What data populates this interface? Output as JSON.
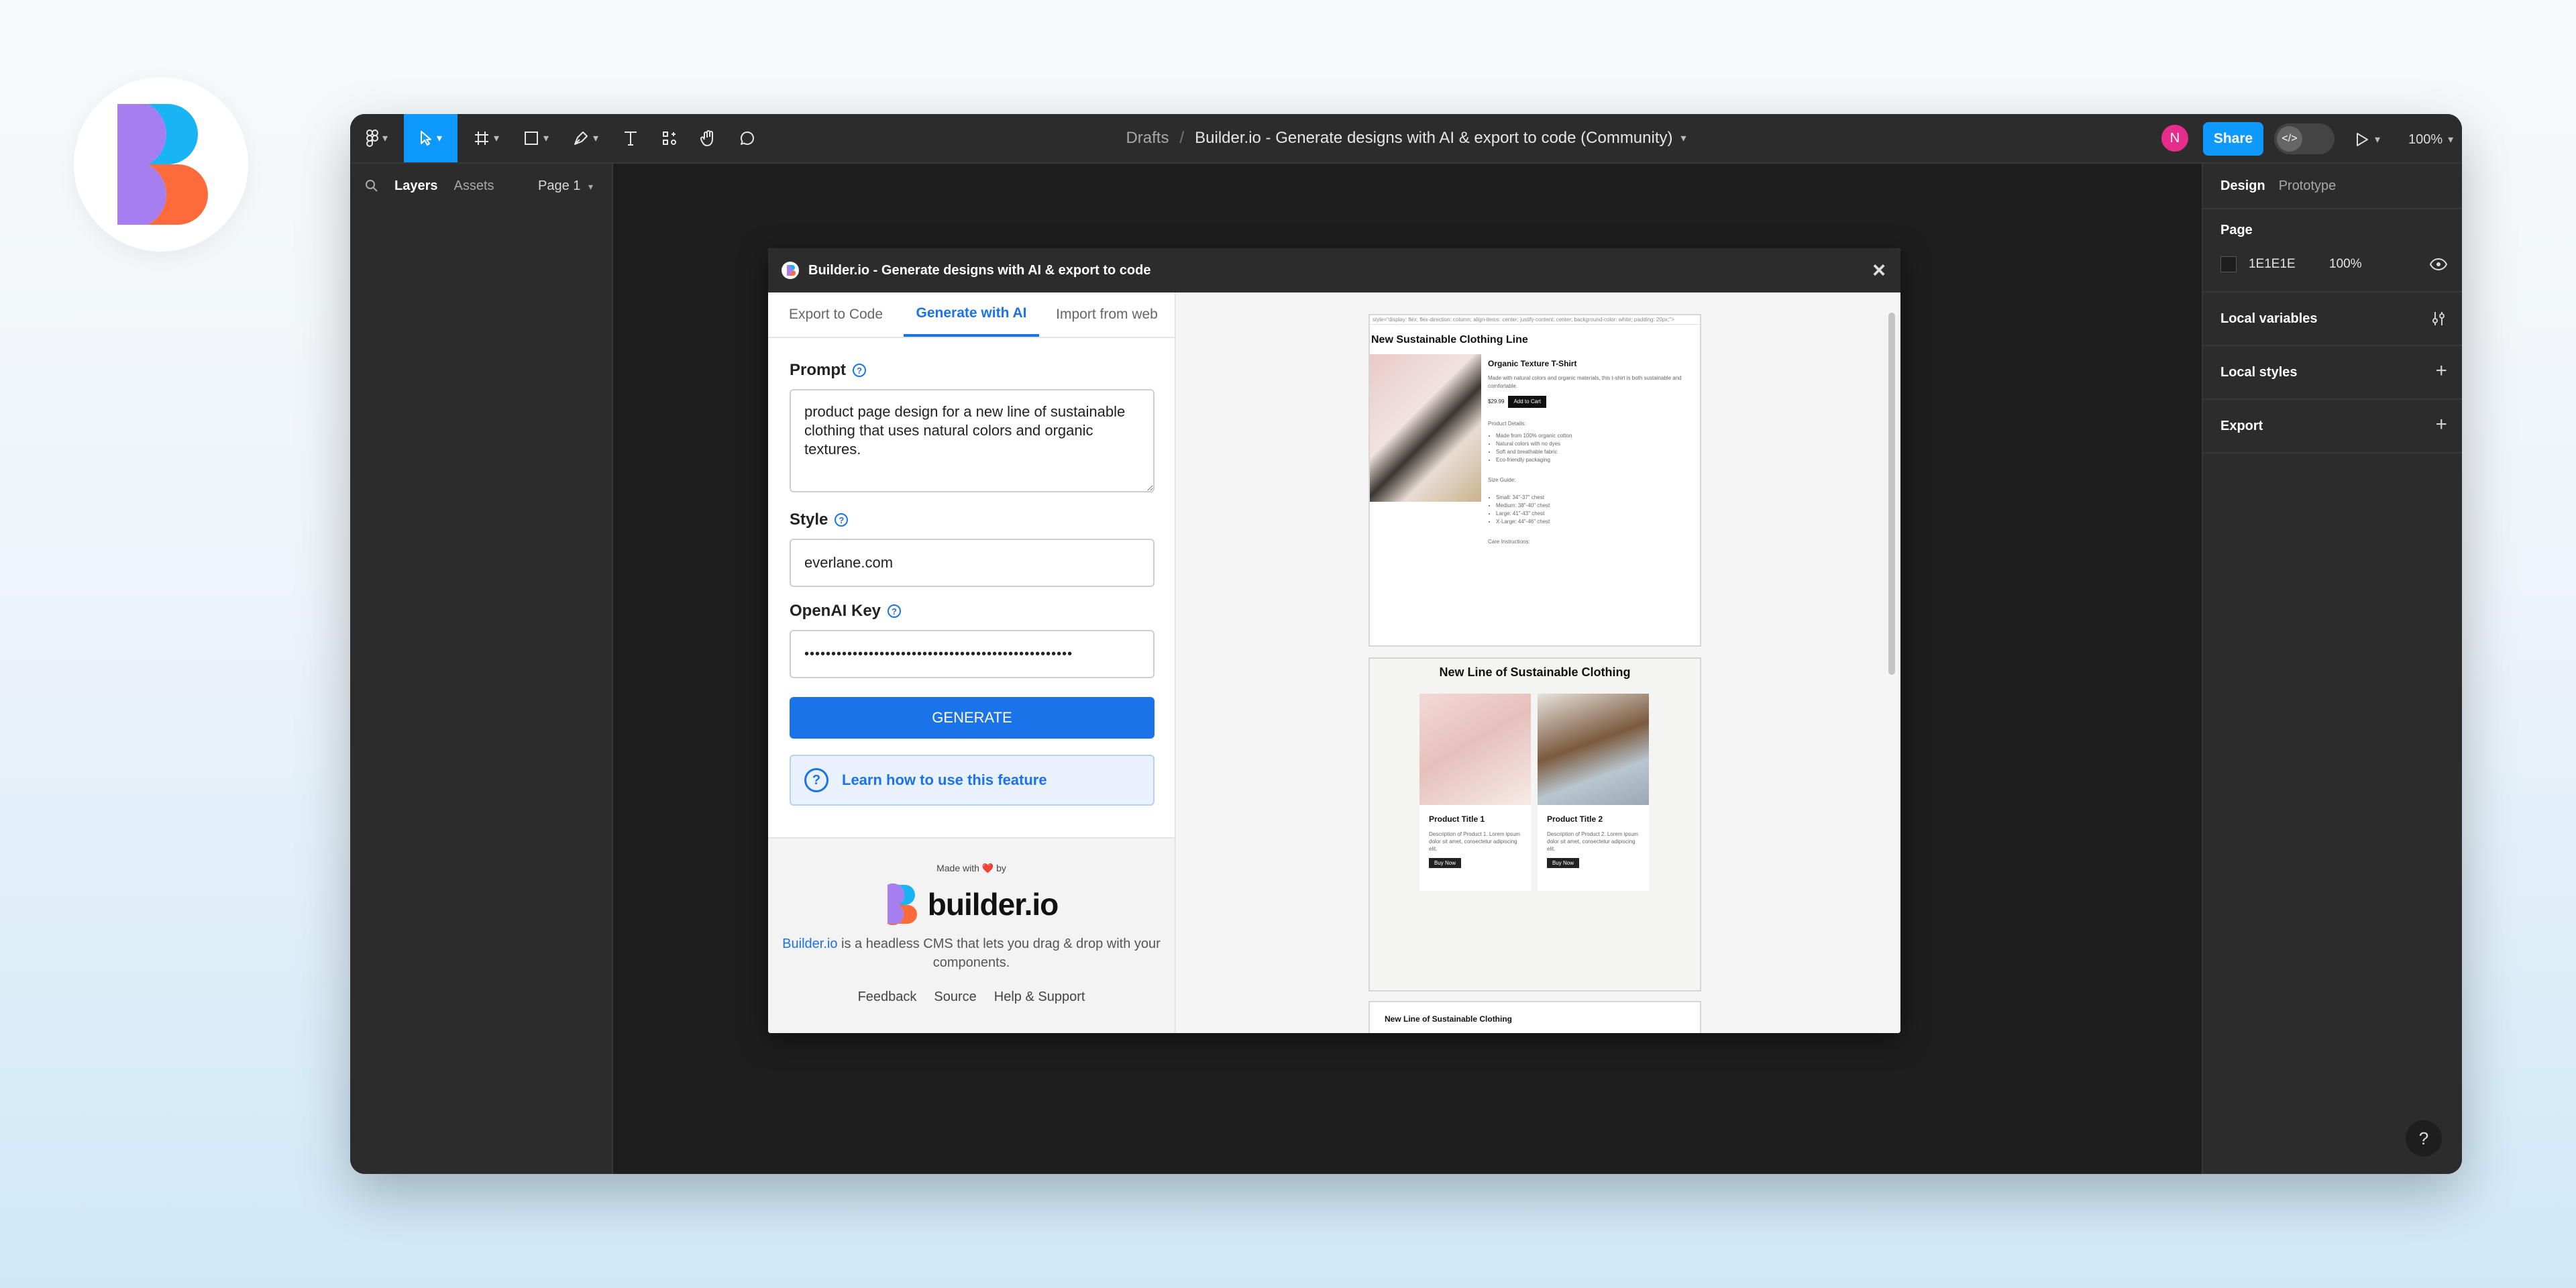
{
  "toolbar": {
    "breadcrumb_parent": "Drafts",
    "breadcrumb_sep": "/",
    "file_title": "Builder.io - Generate designs with AI & export to code (Community)",
    "avatar_initial": "N",
    "share_label": "Share",
    "dev_mode_glyph": "</>",
    "zoom": "100%"
  },
  "left_panel": {
    "tab_layers": "Layers",
    "tab_assets": "Assets",
    "page_select": "Page 1"
  },
  "right_panel": {
    "tab_design": "Design",
    "tab_prototype": "Prototype",
    "page_section": "Page",
    "page_color": "1E1E1E",
    "page_opacity": "100%",
    "local_variables": "Local variables",
    "local_styles": "Local styles",
    "export": "Export",
    "help": "?"
  },
  "plugin": {
    "title": "Builder.io - Generate designs with AI & export to code",
    "tabs": [
      "Export to Code",
      "Generate with AI",
      "Import from web"
    ],
    "prompt_label": "Prompt",
    "prompt_value": "product page design for a new line of sustainable clothing that uses natural colors and organic textures.",
    "style_label": "Style",
    "style_value": "everlane.com",
    "key_label": "OpenAI Key",
    "key_value": "••••••••••••••••••••••••••••••••••••••••••••••••••",
    "generate_label": "GENERATE",
    "learn_label": "Learn how to use this feature",
    "made_with": "Made with ❤️ by",
    "brand_word": "builder.io",
    "tagline_link": "Builder.io",
    "tagline_rest": " is a headless CMS that lets you drag & drop with your components.",
    "footer_links": [
      "Feedback",
      "Source",
      "Help & Support"
    ]
  },
  "preview": {
    "card1": {
      "code_line": "style=\"display: flex; flex-direction: column; align-items: center; justify-content: center; background-color: white; padding: 20px;\">",
      "heading": "New Sustainable Clothing Line",
      "product_title": "Organic Texture T-Shirt",
      "description": "Made with natural colors and organic materials, this t-shirt is both sustainable and comfortable.",
      "price": "$29.99",
      "cart_button": "Add to Cart",
      "details_heading": "Product Details:",
      "details": [
        "Made from 100% organic cotton",
        "Natural colors with no dyes",
        "Soft and breathable fabric",
        "Eco-friendly packaging"
      ],
      "size_heading": "Size Guide:",
      "sizes": [
        "Small: 34\"-37\" chest",
        "Medium: 38\"-40\" chest",
        "Large: 41\"-43\" chest",
        "X-Large: 44\"-46\" chest"
      ],
      "care": "Care Instructions:"
    },
    "card2": {
      "heading": "New Line of Sustainable Clothing",
      "products": [
        {
          "title": "Product Title 1",
          "description": "Description of Product 1. Lorem ipsum dolor sit amet, consectetur adipiscing elit.",
          "button": "Buy Now"
        },
        {
          "title": "Product Title 2",
          "description": "Description of Product 2. Lorem ipsum dolor sit amet, consectetur adipiscing elit.",
          "button": "Buy Now"
        }
      ]
    },
    "card3": {
      "heading": "New Line of Sustainable Clothing"
    }
  },
  "colors": {
    "accent": "#1a73e8",
    "figma_blue": "#0d99ff",
    "canvas": "#1e1e1e",
    "panel": "#2c2c2c",
    "avatar": "#e72c8b"
  }
}
